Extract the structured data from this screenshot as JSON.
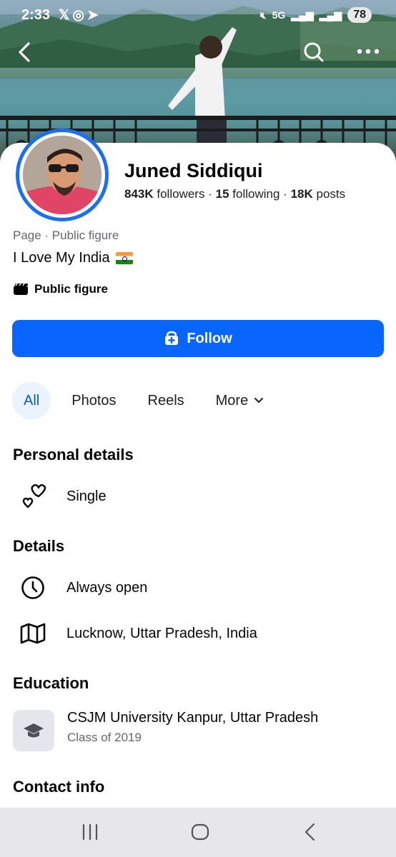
{
  "status_bar": {
    "time": "2:33",
    "left_icons": [
      "x-app-icon",
      "whatsapp-icon",
      "telegram-icon"
    ],
    "network": "5G",
    "battery": "78"
  },
  "profile": {
    "name": "Juned Siddiqui",
    "followers_count": "843K",
    "followers_label": "followers",
    "following_count": "15",
    "following_label": "following",
    "posts_count": "18K",
    "posts_label": "posts",
    "separator": "·",
    "category": "Page · Public figure",
    "bio": "I Love My India",
    "badge": "Public figure"
  },
  "actions": {
    "follow_label": "Follow"
  },
  "tabs": [
    {
      "label": "All",
      "active": true
    },
    {
      "label": "Photos",
      "active": false
    },
    {
      "label": "Reels",
      "active": false
    },
    {
      "label": "More",
      "active": false
    }
  ],
  "personal_details": {
    "title": "Personal details",
    "relationship": "Single"
  },
  "details": {
    "title": "Details",
    "hours": "Always open",
    "location": "Lucknow, Uttar Pradesh, India"
  },
  "education": {
    "title": "Education",
    "school": "CSJM University Kanpur, Uttar Pradesh",
    "class_of": "Class of 2019"
  },
  "contact": {
    "title": "Contact info"
  },
  "colors": {
    "accent": "#0866ff",
    "avatar_ring": "#1a6ff5",
    "tab_active_bg": "#ebf3ff",
    "secondary_text": "#65676b"
  }
}
